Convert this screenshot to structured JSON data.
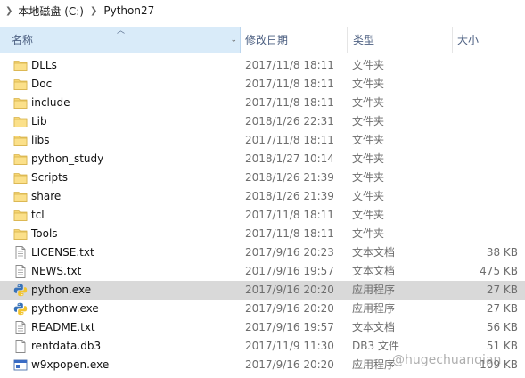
{
  "breadcrumb": {
    "drive": "本地磁盘 (C:)",
    "folder": "Python27"
  },
  "columns": {
    "name": "名称",
    "date": "修改日期",
    "type": "类型",
    "size": "大小"
  },
  "files": [
    {
      "name": "DLLs",
      "date": "2017/11/8 18:11",
      "type": "文件夹",
      "size": "",
      "icon": "folder-icon"
    },
    {
      "name": "Doc",
      "date": "2017/11/8 18:11",
      "type": "文件夹",
      "size": "",
      "icon": "folder-icon"
    },
    {
      "name": "include",
      "date": "2017/11/8 18:11",
      "type": "文件夹",
      "size": "",
      "icon": "folder-icon"
    },
    {
      "name": "Lib",
      "date": "2018/1/26 22:31",
      "type": "文件夹",
      "size": "",
      "icon": "folder-icon"
    },
    {
      "name": "libs",
      "date": "2017/11/8 18:11",
      "type": "文件夹",
      "size": "",
      "icon": "folder-icon"
    },
    {
      "name": "python_study",
      "date": "2018/1/27 10:14",
      "type": "文件夹",
      "size": "",
      "icon": "folder-icon"
    },
    {
      "name": "Scripts",
      "date": "2018/1/26 21:39",
      "type": "文件夹",
      "size": "",
      "icon": "folder-icon"
    },
    {
      "name": "share",
      "date": "2018/1/26 21:39",
      "type": "文件夹",
      "size": "",
      "icon": "folder-icon"
    },
    {
      "name": "tcl",
      "date": "2017/11/8 18:11",
      "type": "文件夹",
      "size": "",
      "icon": "folder-icon"
    },
    {
      "name": "Tools",
      "date": "2017/11/8 18:11",
      "type": "文件夹",
      "size": "",
      "icon": "folder-icon"
    },
    {
      "name": "LICENSE.txt",
      "date": "2017/9/16 20:23",
      "type": "文本文档",
      "size": "38 KB",
      "icon": "text-file-icon"
    },
    {
      "name": "NEWS.txt",
      "date": "2017/9/16 19:57",
      "type": "文本文档",
      "size": "475 KB",
      "icon": "text-file-icon"
    },
    {
      "name": "python.exe",
      "date": "2017/9/16 20:20",
      "type": "应用程序",
      "size": "27 KB",
      "icon": "python-icon",
      "selected": true
    },
    {
      "name": "pythonw.exe",
      "date": "2017/9/16 20:20",
      "type": "应用程序",
      "size": "27 KB",
      "icon": "python-icon"
    },
    {
      "name": "README.txt",
      "date": "2017/9/16 19:57",
      "type": "文本文档",
      "size": "56 KB",
      "icon": "text-file-icon"
    },
    {
      "name": "rentdata.db3",
      "date": "2017/11/9 11:30",
      "type": "DB3 文件",
      "size": "51 KB",
      "icon": "blank-file-icon"
    },
    {
      "name": "w9xpopen.exe",
      "date": "2017/9/16 20:20",
      "type": "应用程序",
      "size": "109 KB",
      "icon": "app-window-icon"
    }
  ],
  "watermark": "@hugechuanqian"
}
